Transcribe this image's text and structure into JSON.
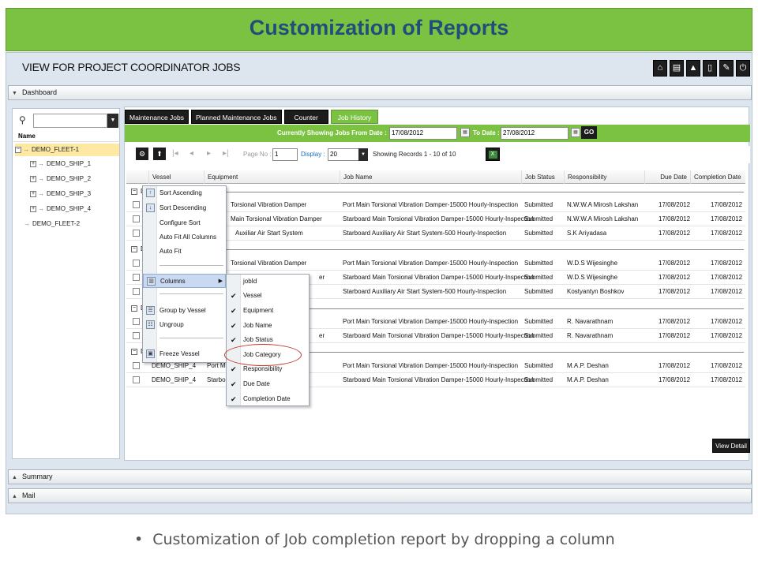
{
  "slide_title": "Customization of Reports",
  "caption": "Customization of Job completion report by dropping a column",
  "app": {
    "page_heading": "VIEW FOR PROJECT COORDINATOR JOBS",
    "toolbar_icons": [
      "home-icon",
      "print-icon",
      "warning-icon",
      "document-icon",
      "edit-icon",
      "power-icon"
    ],
    "dashboard_label": "Dashboard",
    "summary_label": "Summary",
    "mail_label": "Mail",
    "tree": {
      "header": "Name",
      "nodes": [
        "DEMO_FLEET-1",
        "DEMO_SHIP_1",
        "DEMO_SHIP_2",
        "DEMO_SHIP_3",
        "DEMO_SHIP_4",
        "DEMO_FLEET-2"
      ]
    },
    "tabs": [
      "Maintenance Jobs",
      "Planned Maintenance Jobs",
      "Counter",
      "Job History"
    ],
    "active_tab": "Job History",
    "filter": {
      "from_label": "Currently Showing Jobs From Date :",
      "from_value": "17/08/2012",
      "to_label": "To Date :",
      "to_value": "27/08/2012",
      "go_label": "GO"
    },
    "paging": {
      "page_label": "Page No :",
      "page_value": "1",
      "display_label": "Display :",
      "display_value": "20",
      "records_text": "Showing Records 1 - 10 of 10"
    },
    "columns": [
      "Vessel",
      "Equipment",
      "Job Name",
      "Job Status",
      "Responsibility",
      "Due Date",
      "Completion Date"
    ],
    "group_label": "D",
    "rows": [
      {
        "vessel": "",
        "equipment": "Torsional Vibration Damper",
        "job": "Port Main Torsional Vibration Damper-15000 Hourly-Inspection",
        "status": "Submitted",
        "resp": "N.W.W.A Mirosh Lakshan",
        "due": "17/08/2012",
        "comp": "17/08/2012"
      },
      {
        "vessel": "",
        "equipment": "Main Torsional Vibration Damper",
        "job": "Starboard Main Torsional Vibration Damper-15000 Hourly-Inspection",
        "status": "Submitted",
        "resp": "N.W.W.A Mirosh Lakshan",
        "due": "17/08/2012",
        "comp": "17/08/2012"
      },
      {
        "vessel": "",
        "equipment": "Auxiliar Air Start System",
        "job": "Starboard Auxiliary Air Start System-500 Hourly-Inspection",
        "status": "Submitted",
        "resp": "S.K Ariyadasa",
        "due": "17/08/2012",
        "comp": "17/08/2012"
      },
      {
        "vessel": "",
        "equipment": "Torsional Vibration Damper",
        "job": "Port Main Torsional Vibration Damper-15000 Hourly-Inspection",
        "status": "Submitted",
        "resp": "W.D.S Wijesinghe",
        "due": "17/08/2012",
        "comp": "17/08/2012"
      },
      {
        "vessel": "",
        "equipment": "er",
        "job": "Starboard Main Torsional Vibration Damper-15000 Hourly-Inspection",
        "status": "Submitted",
        "resp": "W.D.S Wijesinghe",
        "due": "17/08/2012",
        "comp": "17/08/2012"
      },
      {
        "vessel": "",
        "equipment": "",
        "job": "Starboard Auxiliary Air Start System-500 Hourly-Inspection",
        "status": "Submitted",
        "resp": "Kostyantyn Boshkov",
        "due": "17/08/2012",
        "comp": "17/08/2012"
      },
      {
        "vessel": "",
        "equipment": "",
        "job": "Port Main Torsional Vibration Damper-15000 Hourly-Inspection",
        "status": "Submitted",
        "resp": "R. Navarathnam",
        "due": "17/08/2012",
        "comp": "17/08/2012"
      },
      {
        "vessel": "",
        "equipment": "er",
        "job": "Starboard Main Torsional Vibration Damper-15000 Hourly-Inspection",
        "status": "Submitted",
        "resp": "R. Navarathnam",
        "due": "17/08/2012",
        "comp": "17/08/2012"
      },
      {
        "vessel": "DEMO_SHIP_4",
        "equipment": "Port Main",
        "job": "Port Main Torsional Vibration Damper-15000 Hourly-Inspection",
        "status": "Submitted",
        "resp": "M.A.P. Deshan",
        "due": "17/08/2012",
        "comp": "17/08/2012"
      },
      {
        "vessel": "DEMO_SHIP_4",
        "equipment": "Starboard",
        "job": "Starboard Main Torsional Vibration Damper-15000 Hourly-Inspection",
        "status": "Submitted",
        "resp": "M.A.P. Deshan",
        "due": "17/08/2012",
        "comp": "17/08/2012"
      }
    ],
    "context_menu": [
      "Sort Ascending",
      "Sort Descending",
      "Configure Sort",
      "Auto Fit All Columns",
      "Auto Fit",
      "Columns",
      "Group by Vessel",
      "Ungroup",
      "Freeze Vessel"
    ],
    "columns_menu": [
      {
        "label": "jobId",
        "checked": false
      },
      {
        "label": "Vessel",
        "checked": true
      },
      {
        "label": "Equipment",
        "checked": true
      },
      {
        "label": "Job Name",
        "checked": true
      },
      {
        "label": "Job Status",
        "checked": true
      },
      {
        "label": "Job Category",
        "checked": false
      },
      {
        "label": "Responsibility",
        "checked": true
      },
      {
        "label": "Due Date",
        "checked": true
      },
      {
        "label": "Completion Date",
        "checked": true
      }
    ],
    "view_detail_label": "View Detail"
  },
  "colors": {
    "accent_green": "#7cc242",
    "title_blue": "#1f4e79",
    "highlight_red": "#c0392b"
  }
}
